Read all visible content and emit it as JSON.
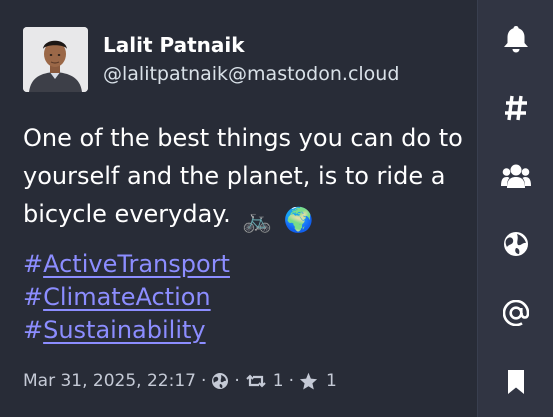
{
  "post": {
    "display_name": "Lalit Patnaik",
    "handle": "@lalitpatnaik@mastodon.cloud",
    "text": "One of the best things you can do to yourself and the planet, is to ride a bicycle everyday.",
    "emojis": [
      "🚲",
      "🌍"
    ],
    "hashtags": [
      {
        "hash": "#",
        "word": "ActiveTransport"
      },
      {
        "hash": "#",
        "word": "ClimateAction"
      },
      {
        "hash": "#",
        "word": "Sustainability"
      }
    ],
    "timestamp": "Mar 31, 2025, 22:17",
    "separator": "·",
    "visibility_icon": "globe-icon",
    "boosts": "1",
    "favourites": "1"
  },
  "sidebar": {
    "icons": [
      "bell-icon",
      "hashtag-icon",
      "people-icon",
      "globe-icon",
      "at-icon",
      "bookmark-icon"
    ]
  },
  "colors": {
    "background": "#282c37",
    "sidebar_background": "#313543",
    "link": "#8c8dff",
    "meta": "#c5cad6"
  }
}
